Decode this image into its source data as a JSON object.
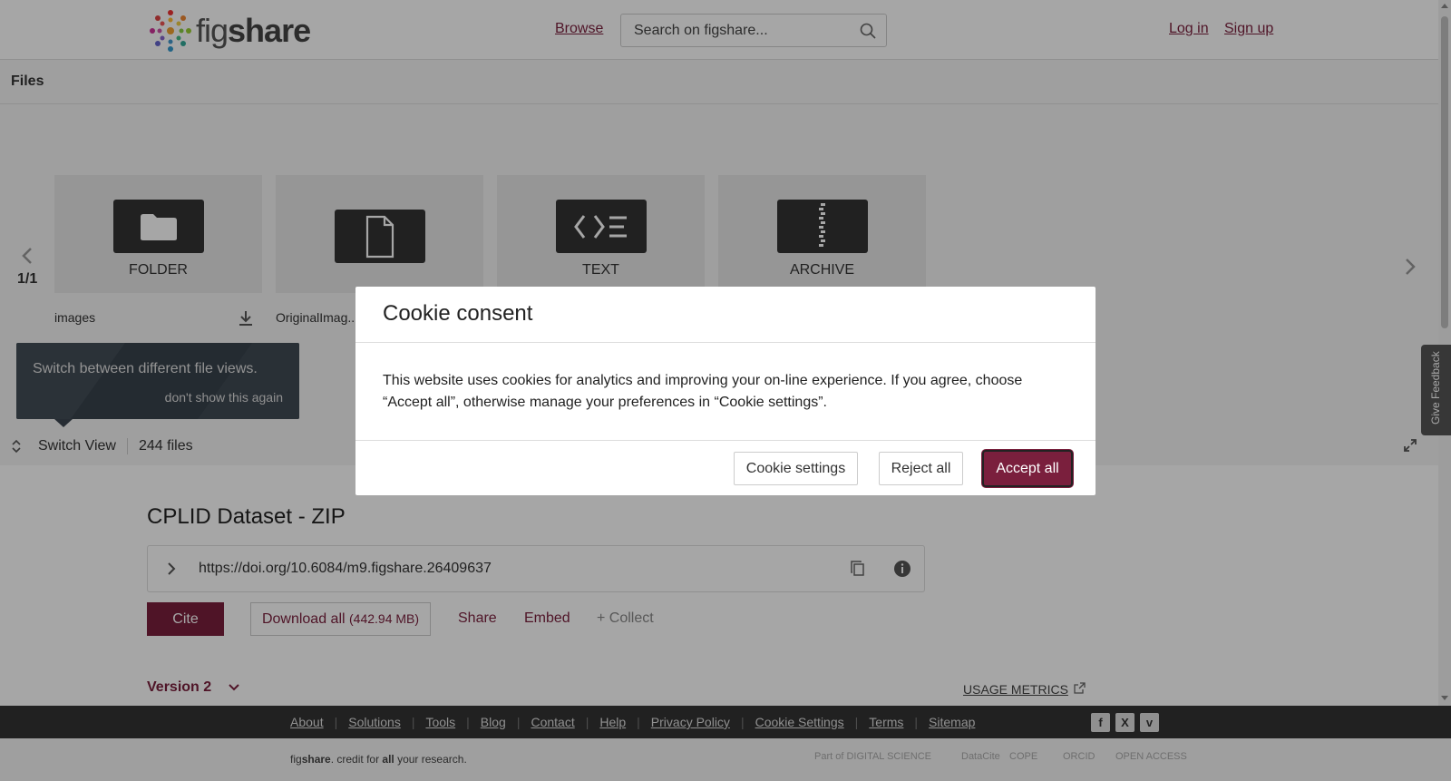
{
  "header": {
    "logo_text_light": "fig",
    "logo_text_bold": "share",
    "browse_label": "Browse",
    "search_placeholder": "Search on figshare...",
    "login_label": "Log in",
    "signup_label": "Sign up"
  },
  "files_bar": {
    "title": "Files"
  },
  "carousel": {
    "page": "1/1",
    "tiles": [
      {
        "type_label": "FOLDER",
        "name": "images",
        "icon": "folder-icon"
      },
      {
        "type_label": "",
        "name": "OriginalImag...",
        "icon": "file-icon"
      },
      {
        "type_label": "TEXT",
        "name": "",
        "icon": "code-icon"
      },
      {
        "type_label": "ARCHIVE",
        "name": "",
        "icon": "archive-icon"
      }
    ]
  },
  "tooltip": {
    "text": "Switch between different file views.",
    "dismiss": "don't show this again"
  },
  "view_bar": {
    "switch_label": "Switch View",
    "file_count": "244 files"
  },
  "dataset": {
    "title": "CPLID Dataset - ZIP",
    "doi": "https://doi.org/10.6084/m9.figshare.26409637",
    "cite_label": "Cite",
    "download_label": "Download all",
    "download_size": "(442.94 MB)",
    "share_label": "Share",
    "embed_label": "Embed",
    "collect_label": "+ Collect",
    "version_label": "Version 2",
    "usage_label": "USAGE METRICS"
  },
  "footer": {
    "links": [
      "About",
      "Solutions",
      "Tools",
      "Blog",
      "Contact",
      "Help",
      "Privacy Policy",
      "Cookie Settings",
      "Terms",
      "Sitemap"
    ],
    "social": [
      "facebook-icon",
      "x-icon",
      "vimeo-icon"
    ],
    "tagline_pre": "fig",
    "tagline_bold": "share",
    "tagline_mid": ". credit for ",
    "tagline_all": "all",
    "tagline_post": " your research.",
    "partners": [
      "Part of DIGITAL SCIENCE",
      "DataCite",
      "COPE",
      "ORCID",
      "OPEN ACCESS"
    ]
  },
  "feedback": {
    "label": "Give Feedback"
  },
  "cookie_modal": {
    "title": "Cookie consent",
    "body": "This website uses cookies for analytics and improving your on-line experience. If you agree, choose “Accept all”, otherwise manage your preferences in “Cookie settings”.",
    "settings_label": "Cookie settings",
    "reject_label": "Reject all",
    "accept_label": "Accept all"
  },
  "colors": {
    "brand": "#7a1f3d",
    "tile_icon": "#333333",
    "footer_bg": "#333333"
  }
}
